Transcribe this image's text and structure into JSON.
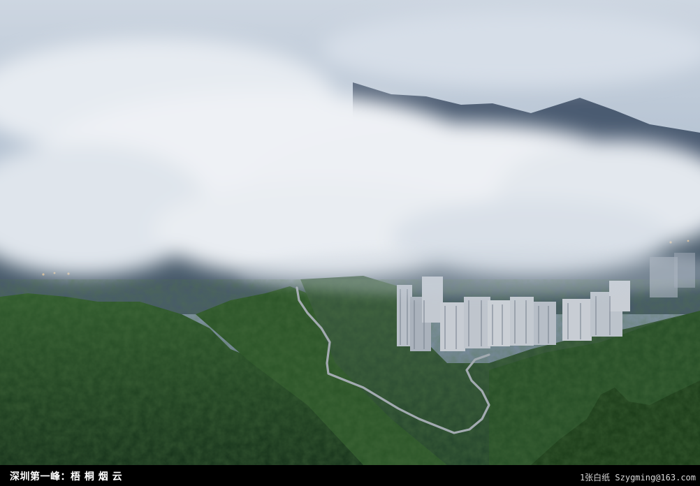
{
  "caption": {
    "title": "深圳第一峰：梧 桐 烟 云",
    "credit": "1张白纸 Szygming@163.com"
  },
  "photo": {
    "subject": "landscape-photo",
    "colors": {
      "sky_top": "#c9d3df",
      "sky_mid": "#a7b6c8",
      "cloud": "#eef1f5",
      "mountain_far": "#3f5066",
      "forest_dark": "#1c3a1c",
      "forest_mid": "#2f5a2a",
      "road": "#9aa3a8",
      "building": "#c8ccd2"
    }
  }
}
